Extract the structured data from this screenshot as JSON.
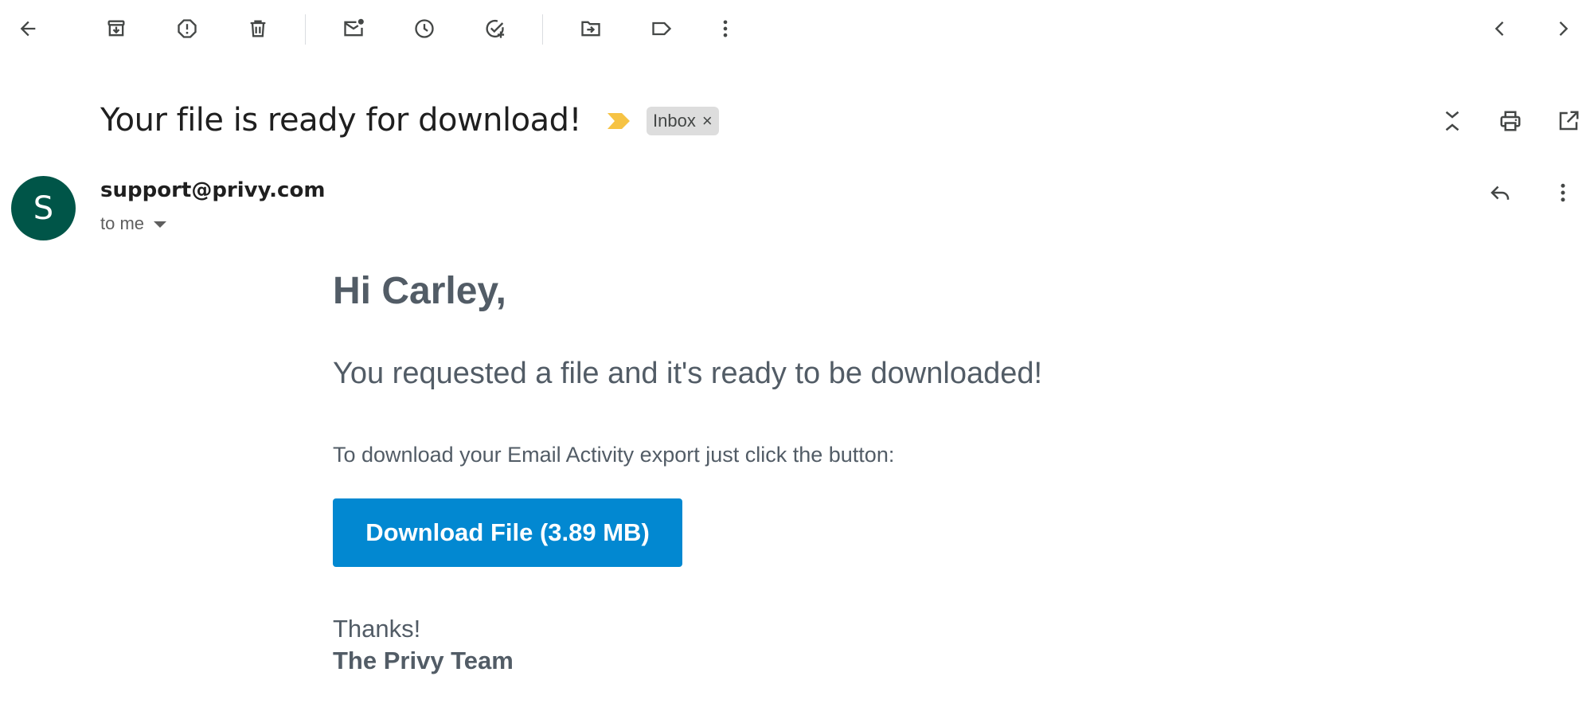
{
  "toolbar": {
    "icons": [
      "back-arrow-icon",
      "archive-icon",
      "report-spam-icon",
      "delete-icon",
      "mark-unread-icon",
      "snooze-icon",
      "add-task-icon",
      "move-to-icon",
      "label-icon",
      "more-vert-icon",
      "newer-chevron-icon",
      "older-chevron-icon"
    ]
  },
  "email": {
    "subject": "Your file is ready for download!",
    "label_chip": "Inbox",
    "label_chip_close": "×",
    "sender": "support@privy.com",
    "avatar_letter": "S",
    "recipient": "to me",
    "greeting": "Hi Carley,",
    "intro": "You requested a file and it's ready to be downloaded!",
    "instruction": "To download your Email Activity export just click the button:",
    "download_button": "Download File (3.89 MB)",
    "thanks": "Thanks!",
    "signature": "The Privy Team"
  },
  "colors": {
    "avatar": "#005548",
    "button": "#0288d1",
    "importance": "#f6c344",
    "body_text": "#525c66",
    "chip": "#dddddd"
  }
}
